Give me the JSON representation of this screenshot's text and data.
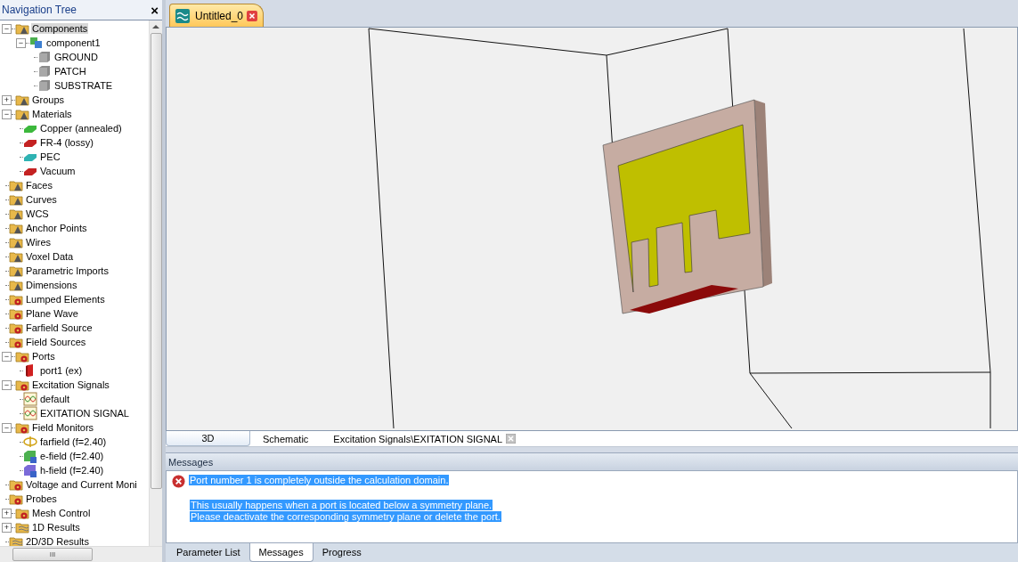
{
  "navigation_tree": {
    "title": "Navigation Tree",
    "close": "×",
    "items": [
      {
        "label": "Components",
        "kind": "folder-alert",
        "expander": "−",
        "selected": true,
        "children": [
          {
            "label": "component1",
            "kind": "component",
            "expander": "−",
            "selected": false,
            "children": [
              {
                "label": "GROUND",
                "kind": "block",
                "selected": false
              },
              {
                "label": "PATCH",
                "kind": "block",
                "selected": false
              },
              {
                "label": "SUBSTRATE",
                "kind": "block",
                "selected": false
              }
            ]
          }
        ]
      },
      {
        "label": "Groups",
        "kind": "folder-alert",
        "expander": "+",
        "selected": false
      },
      {
        "label": "Materials",
        "kind": "folder-alert",
        "expander": "−",
        "selected": false,
        "children": [
          {
            "label": "Copper (annealed)",
            "kind": "material",
            "color": "#3cb83c",
            "selected": false
          },
          {
            "label": "FR-4 (lossy)",
            "kind": "material",
            "color": "#c42222",
            "selected": false
          },
          {
            "label": "PEC",
            "kind": "material",
            "color": "#2fb3b3",
            "selected": false
          },
          {
            "label": "Vacuum",
            "kind": "material",
            "color": "#c42222",
            "selected": false
          }
        ]
      },
      {
        "label": "Faces",
        "kind": "folder-alert",
        "selected": false
      },
      {
        "label": "Curves",
        "kind": "folder-alert",
        "selected": false
      },
      {
        "label": "WCS",
        "kind": "folder-alert",
        "selected": false
      },
      {
        "label": "Anchor Points",
        "kind": "folder-alert",
        "selected": false
      },
      {
        "label": "Wires",
        "kind": "folder-alert",
        "selected": false
      },
      {
        "label": "Voxel Data",
        "kind": "folder-alert",
        "selected": false
      },
      {
        "label": "Parametric Imports",
        "kind": "folder-alert",
        "selected": false
      },
      {
        "label": "Dimensions",
        "kind": "folder-alert",
        "selected": false
      },
      {
        "label": "Lumped Elements",
        "kind": "folder-gear",
        "selected": false
      },
      {
        "label": "Plane Wave",
        "kind": "folder-gear",
        "selected": false
      },
      {
        "label": "Farfield Source",
        "kind": "folder-gear",
        "selected": false
      },
      {
        "label": "Field Sources",
        "kind": "folder-gear",
        "selected": false
      },
      {
        "label": "Ports",
        "kind": "folder-gear",
        "expander": "−",
        "selected": false,
        "children": [
          {
            "label": "port1 (ex)",
            "kind": "port",
            "selected": false
          }
        ]
      },
      {
        "label": "Excitation Signals",
        "kind": "folder-gear",
        "expander": "−",
        "selected": false,
        "children": [
          {
            "label": "default",
            "kind": "signal",
            "selected": false
          },
          {
            "label": "EXITATION SIGNAL",
            "kind": "signal",
            "selected": false
          }
        ]
      },
      {
        "label": "Field Monitors",
        "kind": "folder-gear",
        "expander": "−",
        "selected": false,
        "children": [
          {
            "label": "farfield (f=2.40)",
            "kind": "farfield",
            "selected": false
          },
          {
            "label": "e-field (f=2.40)",
            "kind": "efield",
            "selected": false
          },
          {
            "label": "h-field (f=2.40)",
            "kind": "hfield",
            "selected": false
          }
        ]
      },
      {
        "label": "Voltage and Current Moni",
        "kind": "folder-gear",
        "selected": false
      },
      {
        "label": "Probes",
        "kind": "folder-gear",
        "selected": false
      },
      {
        "label": "Mesh Control",
        "kind": "folder-gear",
        "expander": "+",
        "selected": false
      },
      {
        "label": "1D Results",
        "kind": "folder-results",
        "expander": "+",
        "selected": false
      },
      {
        "label": "2D/3D Results",
        "kind": "folder-results",
        "selected": false
      }
    ],
    "scroll_thumb": "III"
  },
  "document_tabs": [
    {
      "label": "Untitled_0",
      "selected": true
    }
  ],
  "view_tabs": [
    {
      "label": "3D",
      "selected": true,
      "closable": false
    },
    {
      "label": "Schematic",
      "selected": false,
      "closable": false
    },
    {
      "label": "Excitation Signals\\EXITATION SIGNAL",
      "selected": false,
      "closable": true
    }
  ],
  "messages": {
    "title": "Messages",
    "entries": [
      {
        "kind": "error",
        "selected": true,
        "lines": [
          "Port number 1 is completely outside the calculation domain."
        ]
      },
      {
        "kind": "detail",
        "selected": true,
        "lines": [
          "This usually happens when a port is located below a symmetry plane.",
          "Please deactivate the corresponding symmetry plane or delete the port."
        ]
      }
    ]
  },
  "bottom_tabs": [
    {
      "label": "Parameter List",
      "selected": false
    },
    {
      "label": "Messages",
      "selected": true
    },
    {
      "label": "Progress",
      "selected": false
    }
  ]
}
